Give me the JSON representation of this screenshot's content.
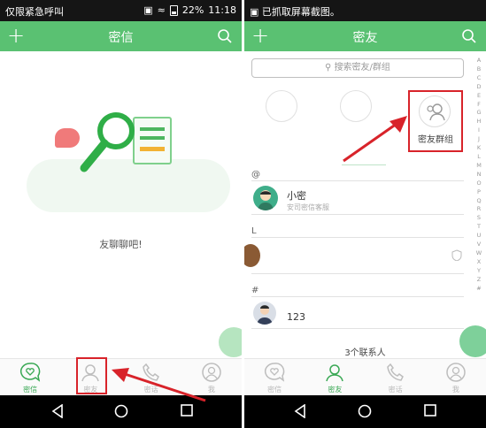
{
  "left": {
    "status": {
      "carrier": "仅限紧急呼叫",
      "battery": "22%",
      "time": "11:18"
    },
    "appbar": {
      "title": "密信"
    },
    "empty_hint": "友聊聊吧!",
    "tabs": [
      {
        "label": "密信"
      },
      {
        "label": "密友"
      },
      {
        "label": "密话"
      },
      {
        "label": "我"
      }
    ]
  },
  "right": {
    "status": {
      "notice": "已抓取屏幕截图。"
    },
    "appbar": {
      "title": "密友"
    },
    "search": {
      "placeholder": "搜索密友/群组"
    },
    "group_button": {
      "label": "密友群组"
    },
    "sections": [
      {
        "header": "@",
        "contacts": [
          {
            "name": "小密",
            "subtitle": "安司密信客服"
          }
        ]
      },
      {
        "header": "L",
        "contacts": [
          {
            "name": "",
            "subtitle": ""
          }
        ]
      },
      {
        "header": "#",
        "contacts": [
          {
            "name": "123",
            "subtitle": ""
          }
        ]
      }
    ],
    "alphabet": [
      "A",
      "B",
      "C",
      "D",
      "E",
      "F",
      "G",
      "H",
      "I",
      "J",
      "K",
      "L",
      "M",
      "N",
      "O",
      "P",
      "Q",
      "R",
      "S",
      "T",
      "U",
      "V",
      "W",
      "X",
      "Y",
      "Z",
      "#"
    ],
    "contact_count": "3个联系人",
    "tabs": [
      {
        "label": "密信"
      },
      {
        "label": "密友"
      },
      {
        "label": "密话"
      },
      {
        "label": "我"
      }
    ]
  },
  "colors": {
    "brand_green": "#5ac172",
    "annotation_red": "#d8232a",
    "active_tab": "#39a854"
  }
}
